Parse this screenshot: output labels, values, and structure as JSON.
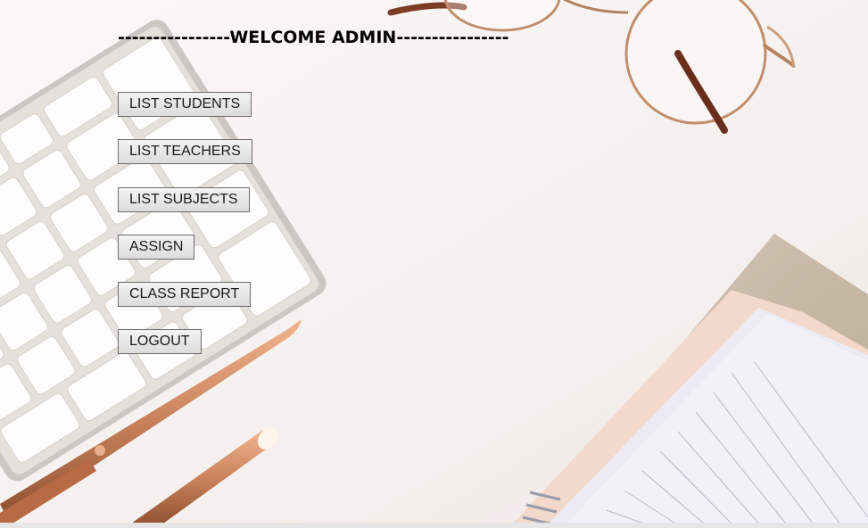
{
  "header": {
    "title": "----------------WELCOME ADMIN----------------"
  },
  "menu": {
    "items": [
      {
        "id": "list-students",
        "label": "LIST STUDENTS"
      },
      {
        "id": "list-teachers",
        "label": "LIST TEACHERS"
      },
      {
        "id": "list-subjects",
        "label": "LIST SUBJECTS"
      },
      {
        "id": "assign",
        "label": "ASSIGN"
      },
      {
        "id": "class-report",
        "label": "CLASS REPORT"
      },
      {
        "id": "logout",
        "label": "LOGOUT"
      }
    ]
  },
  "background": {
    "description_icon": "desk-photo-background",
    "colors": {
      "desk": "#f4efec",
      "keyboard": "#cfcac6",
      "keys": "#fbfbfb",
      "rose_gold": "#c9825b",
      "notebook_cover": "#d9c6b2",
      "notebook_pages": "#ecebf3"
    }
  }
}
